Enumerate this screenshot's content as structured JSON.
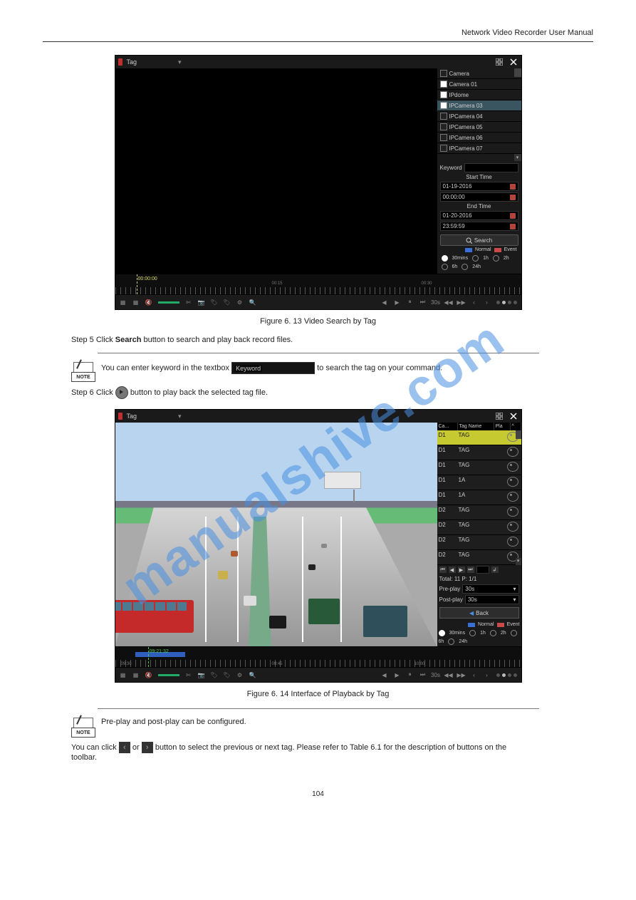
{
  "header": {
    "title": "Network Video Recorder User Manual"
  },
  "watermark_text": "manualshive.com",
  "figA": {
    "topbar_label": "Tag",
    "camera_header": "Camera",
    "cameras": [
      {
        "label": "Camera 01",
        "checked": true,
        "sel": false
      },
      {
        "label": "IPdome",
        "checked": true,
        "sel": false
      },
      {
        "label": "IPCamera 03",
        "checked": true,
        "sel": true
      },
      {
        "label": "IPCamera 04",
        "checked": false,
        "sel": false
      },
      {
        "label": "IPCamera 05",
        "checked": false,
        "sel": false
      },
      {
        "label": "IPCamera 06",
        "checked": false,
        "sel": false
      },
      {
        "label": "IPCamera 07",
        "checked": false,
        "sel": false
      }
    ],
    "keyword_label": "Keyword",
    "starttime_label": "Start Time",
    "start_date": "01-19-2016",
    "start_time": "00:00:00",
    "endtime_label": "End Time",
    "end_date": "01-20-2016",
    "end_time": "23:59:59",
    "search_label": "Search",
    "legend_normal": "Normal",
    "legend_event": "Event",
    "zoom": [
      "30mins",
      "1h",
      "2h",
      "6h",
      "24h"
    ],
    "timeline_marker": "00:00:00",
    "ticks": [
      "00:15",
      "00:30"
    ],
    "caption": "Figure 6. 13 Video Search by Tag"
  },
  "note1": {
    "step_line": "Step 5 Click  Search  button to search and play back record files.",
    "text_before_chip": "You can enter keyword in the textbox",
    "chip_label": "Keyword",
    "text_after_chip": "  to search the tag on your command.",
    "step6_a": "Step 6 Click ",
    "step6_b": "  button to play back the selected tag file."
  },
  "figB": {
    "topbar_label": "Tag",
    "table_head": [
      "Ca...",
      "Tag Name",
      "Pla",
      "^"
    ],
    "rows": [
      {
        "c": "D1",
        "n": "TAG",
        "sel": true
      },
      {
        "c": "D1",
        "n": "TAG"
      },
      {
        "c": "D1",
        "n": "TAG"
      },
      {
        "c": "D1",
        "n": "1A"
      },
      {
        "c": "D1",
        "n": "1A"
      },
      {
        "c": "D2",
        "n": "TAG"
      },
      {
        "c": "D2",
        "n": "TAG"
      },
      {
        "c": "D2",
        "n": "TAG"
      },
      {
        "c": "D2",
        "n": "TAG"
      }
    ],
    "total_label": "Total: 11  P: 1/1",
    "preplay_label": "Pre-play",
    "preplay_value": "30s",
    "postplay_label": "Post-play",
    "postplay_value": "30s",
    "back_label": "Back",
    "zoom": [
      "30mins",
      "1h",
      "2h",
      "6h",
      "24h"
    ],
    "timeline_marker": "09:21:32",
    "ticks_left": "09:30",
    "ticks_mid": "09:45",
    "ticks_right": "10:00",
    "legend_normal": "Normal",
    "legend_event": "Event",
    "caption": "Figure 6. 14 Interface of Playback by Tag"
  },
  "note2": {
    "pre_post": "Pre-play and post-play can be configured.",
    "arrows": "You can click    or    button to select the previous or next tag. Please refer to Table 6.1 for the description of buttons on the toolbar."
  },
  "note_label": "NOTE",
  "page_no": "104"
}
